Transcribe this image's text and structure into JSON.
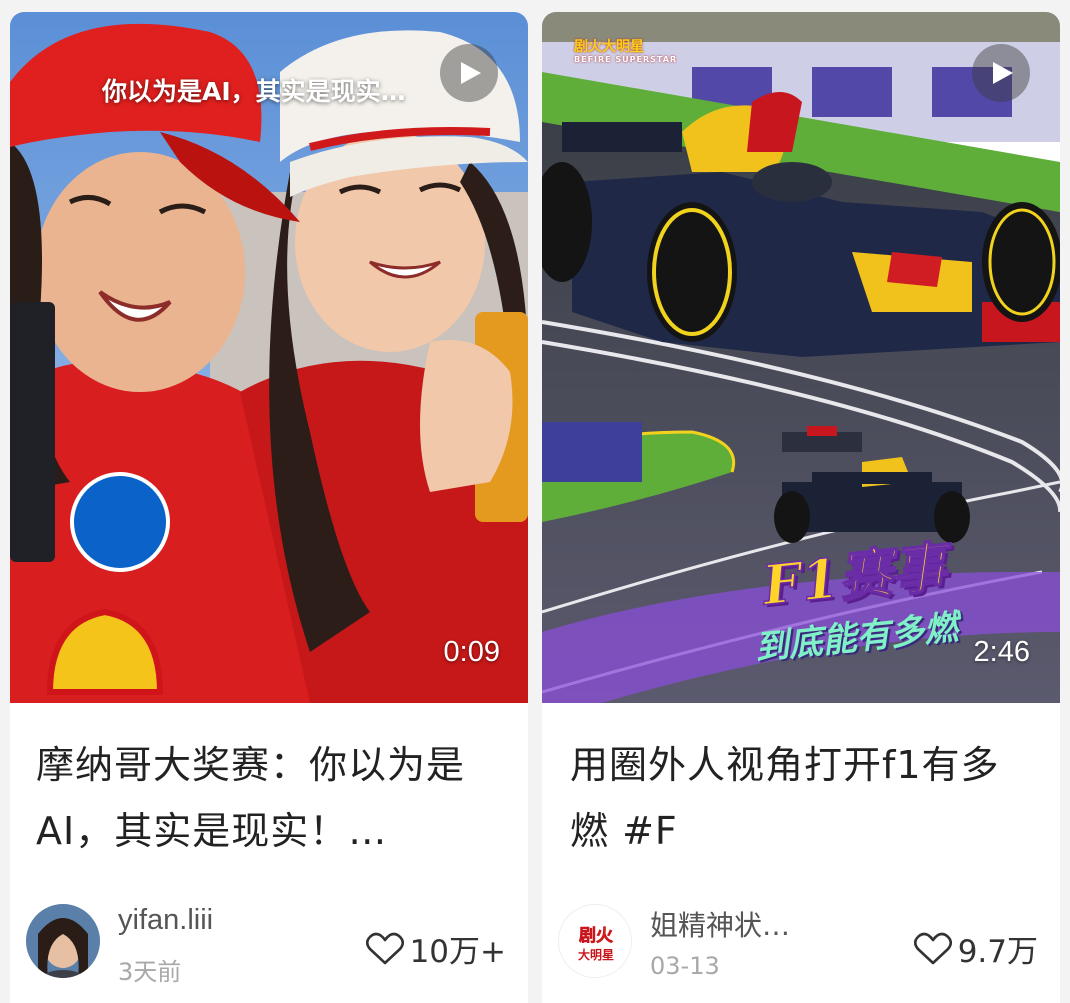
{
  "colors": {
    "background": "#f3f3f3",
    "card": "#ffffff",
    "title_text": "#222222",
    "author_text": "#555555",
    "date_text": "#a8a8a8",
    "ferrari_red": "#d9151b",
    "f1_title_yellow": "#ffd42a",
    "f1_sub_mint": "#7ff0c8"
  },
  "cards": [
    {
      "thumbnail": {
        "overlay_caption": "你以为是AI，其实是现实…",
        "duration": "0:09",
        "play_icon": "play-icon"
      },
      "title": "摩纳哥大奖赛：你以为是AI，其实是现实！…",
      "author": "yifan.liii",
      "date": "3天前",
      "likes": "10万+",
      "like_icon": "heart-outline-icon"
    },
    {
      "thumbnail": {
        "brand_logo": "剧火大明星",
        "brand_logo_sub": "BEFIRE SUPERSTAR",
        "promo_title": "F1赛事",
        "promo_subtitle": "到底能有多燃",
        "duration": "2:46",
        "play_icon": "play-icon"
      },
      "title": "用圈外人视角打开f1有多燃 #F",
      "author": "姐精神状…",
      "date": "03-13",
      "likes": "9.7万",
      "like_icon": "heart-outline-icon",
      "avatar_text": "剧火大明星"
    }
  ]
}
